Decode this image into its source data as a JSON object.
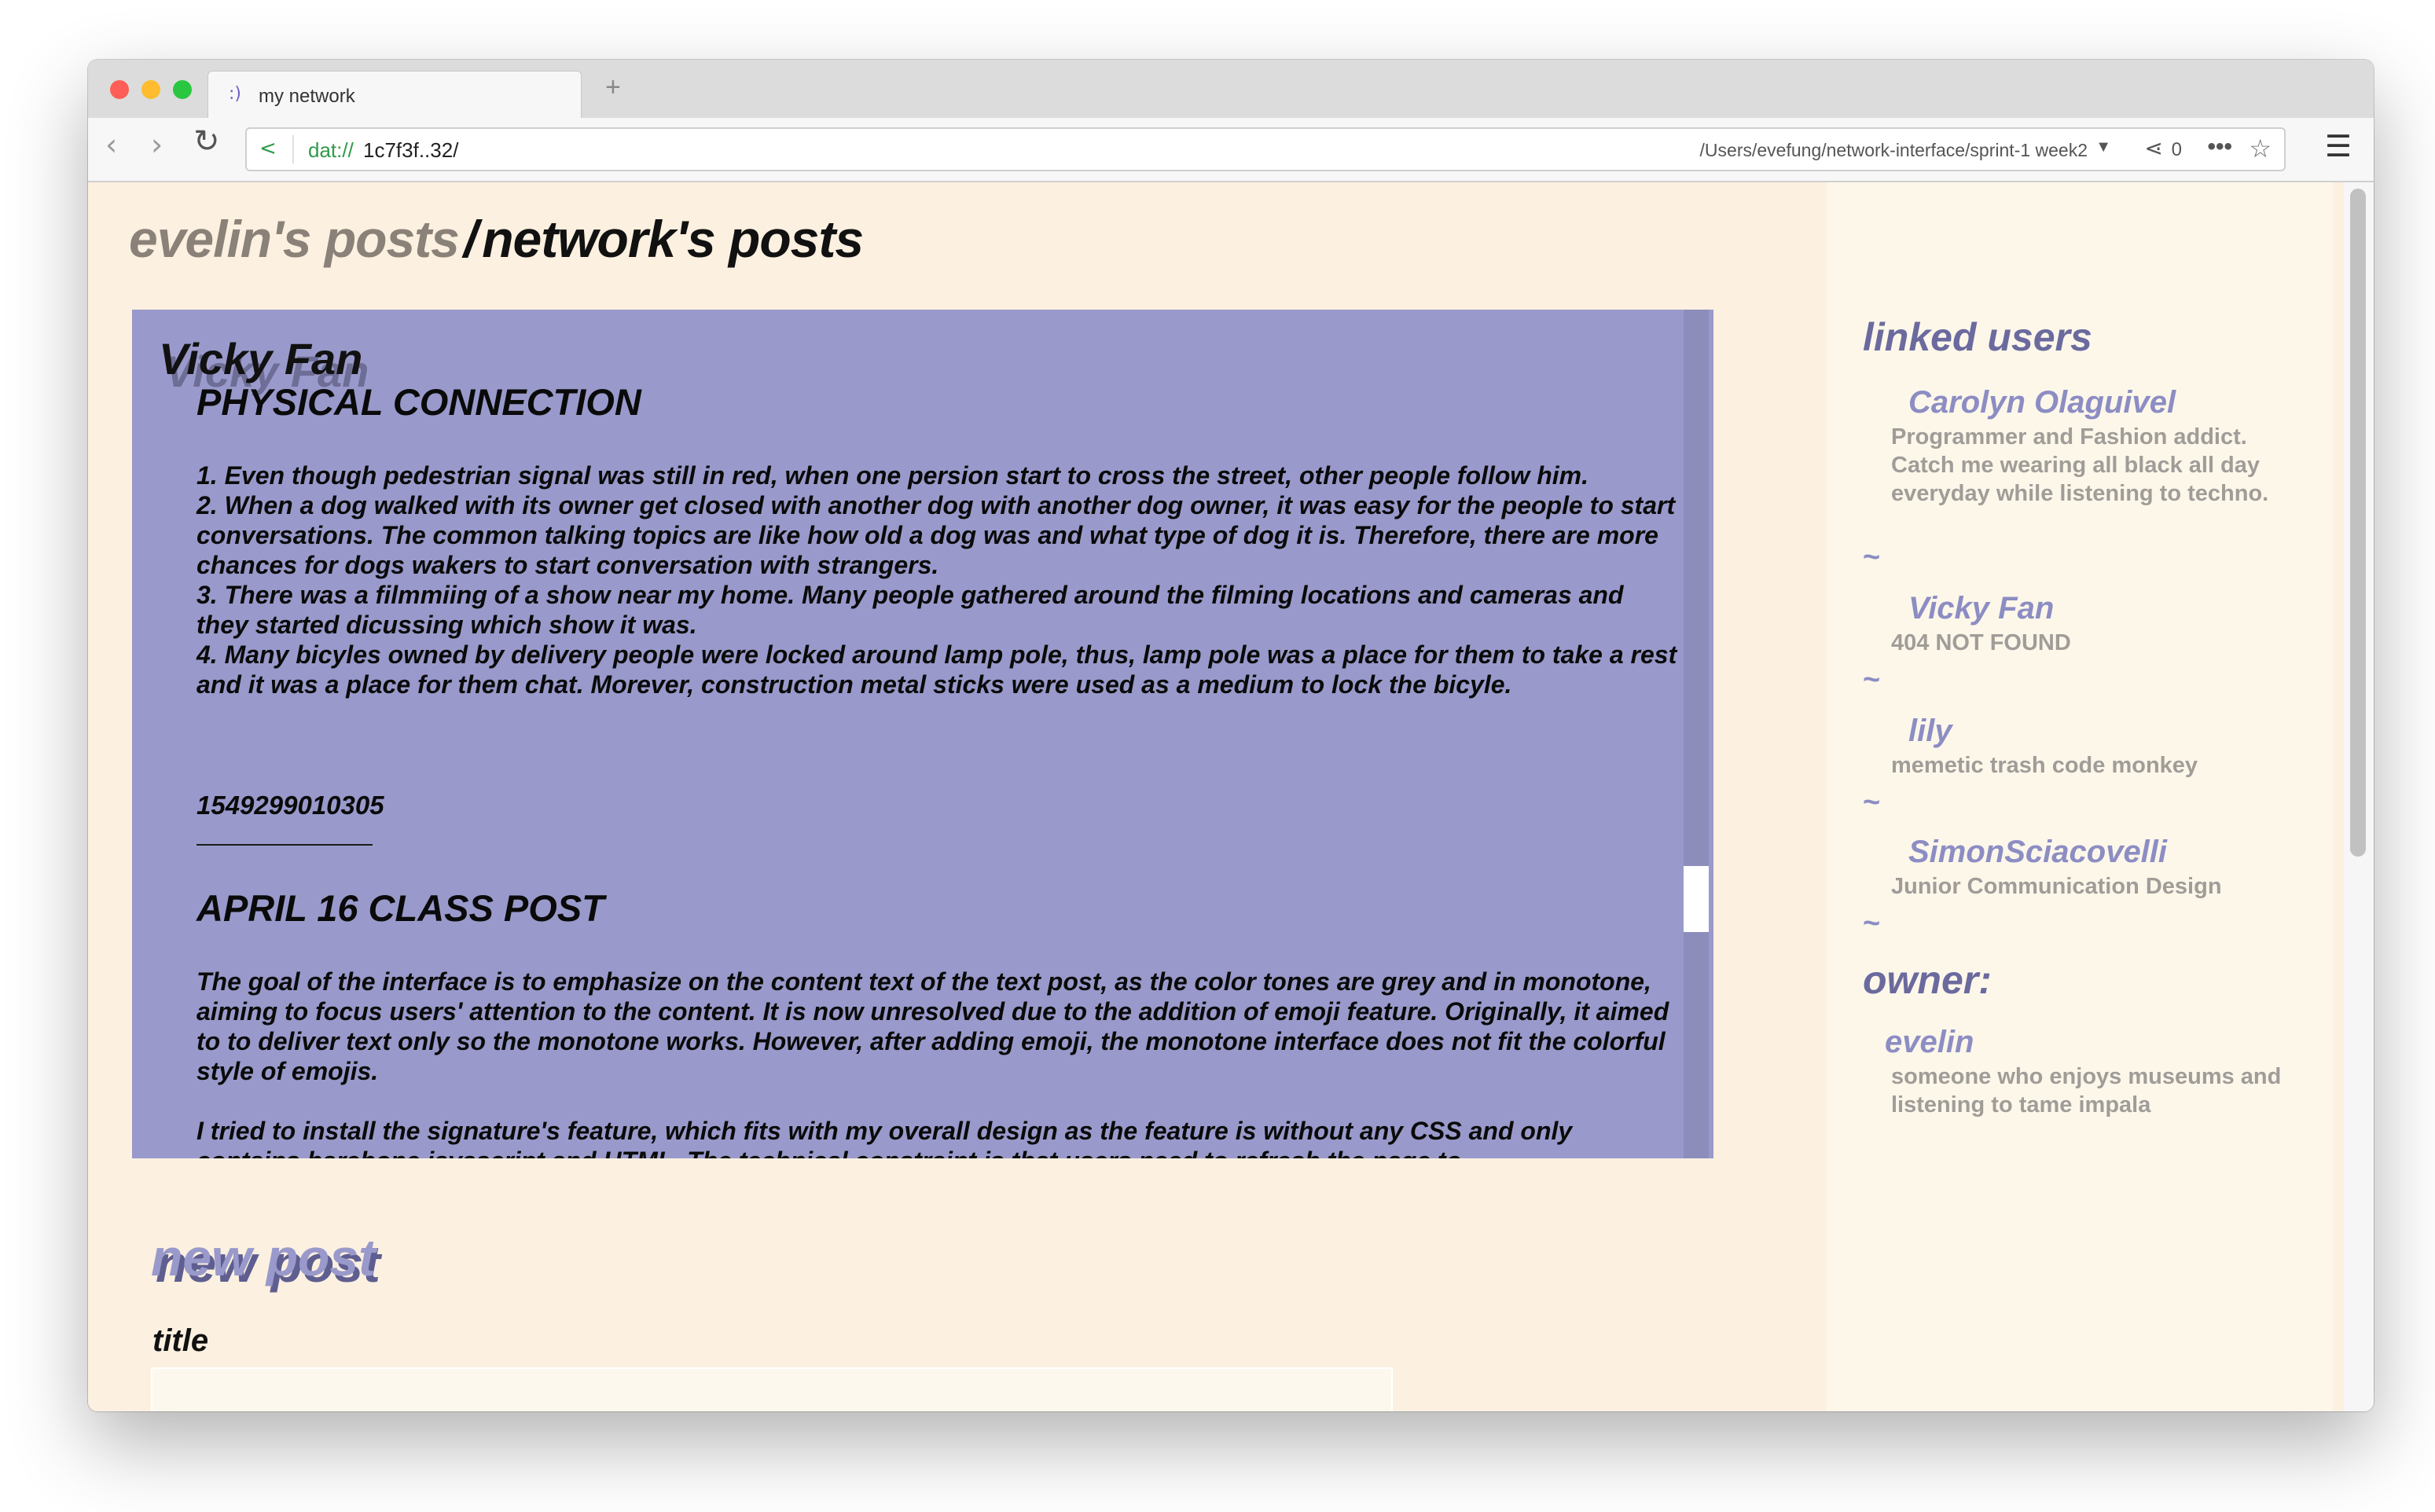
{
  "browser": {
    "tab_title": "my network",
    "tab_favicon": ":)",
    "new_tab": "+",
    "url_scheme": "dat://",
    "url_host": "1c7f3f..32/",
    "local_path": "/Users/evefung/network-interface/sprint-1 week2",
    "peer_count": "0"
  },
  "header": {
    "own_posts": "evelin's posts",
    "separator": "/",
    "network_posts": "network's posts"
  },
  "feed": {
    "author": "Vicky Fan",
    "posts": [
      {
        "title": "PHYSICAL CONNECTION",
        "body": [
          "1. Even though pedestrian signal was still in red, when one persion start to cross the street, other people follow him.",
          "2. When a dog walked with its owner get closed with another dog with another dog owner, it was easy for the people to start conversations. The common talking topics are like how old a dog was and what type of dog it is. Therefore, there are more chances for dogs wakers to start conversation with strangers.",
          "3. There was a filmmiing of a show near my home. Many people gathered around the filming locations and cameras and they started dicussing which show it was.",
          "4. Many bicyles owned by delivery people were locked around lamp pole, thus, lamp pole was a place for them to take a rest and it was a place for them chat. Morever, construction metal sticks were used as a medium to lock the bicyle."
        ],
        "timestamp": "1549299010305"
      },
      {
        "title": "APRIL 16 CLASS POST",
        "body": [
          "The goal of the interface is to emphasize on the content text of the text post, as the color tones are grey and in monotone, aiming to focus users' attention to the content. It is now unresolved due to the addition of emoji feature. Originally, it aimed to to deliver text only so the monotone works. However, after adding emoji, the monotone interface does not fit the colorful style of emojis.",
          "I tried to install the signature's feature, which fits with my overall design as the feature is without any CSS and only contains barebone javascript and HTML. The technical constraint is that users need to refresh the page to"
        ]
      }
    ]
  },
  "new_post": {
    "heading": "new post",
    "title_label": "title"
  },
  "sidebar": {
    "linked_heading": "linked users",
    "separator": "~",
    "users": [
      {
        "name": "Carolyn Olaguivel",
        "bio": "Programmer and Fashion addict. Catch me wearing all black all day everyday while listening to techno."
      },
      {
        "name": "Vicky Fan",
        "bio": "404 NOT FOUND"
      },
      {
        "name": "lily",
        "bio": "memetic trash code monkey"
      },
      {
        "name": "SimonSciacovelli",
        "bio": "Junior Communication Design"
      }
    ],
    "owner_heading": "owner:",
    "owner": {
      "name": "evelin",
      "bio": "someone who enjoys museums and listening to tame impala"
    }
  }
}
